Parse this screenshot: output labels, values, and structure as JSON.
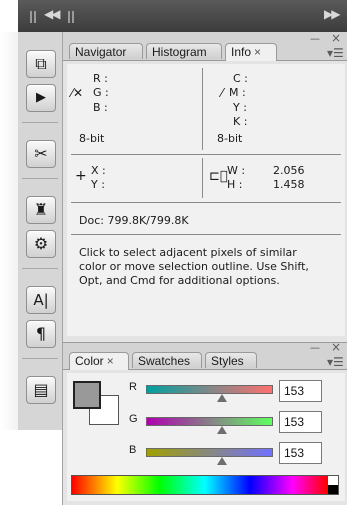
{
  "top_bar": {
    "collapse_icon": "double-left-arrow",
    "expand_icon": "double-right-arrow"
  },
  "tools": [
    {
      "name": "layer-comps-icon",
      "glyph": "⧉"
    },
    {
      "name": "actions-play-icon",
      "glyph": "▶"
    },
    {
      "name": "brushes-icon",
      "glyph": "✂"
    },
    {
      "name": "clone-source-icon",
      "glyph": "♜"
    },
    {
      "name": "tool-presets-icon",
      "glyph": "⚙"
    },
    {
      "name": "character-icon",
      "glyph": "A|"
    },
    {
      "name": "paragraph-icon",
      "glyph": "¶"
    },
    {
      "name": "notes-icon",
      "glyph": "▤"
    }
  ],
  "info_panel": {
    "tabs": [
      {
        "label": "Navigator"
      },
      {
        "label": "Histogram"
      },
      {
        "label": "Info",
        "close": "×"
      }
    ],
    "collapse": "––",
    "close": "×",
    "rgb": {
      "r_label": "R :",
      "g_label": "G :",
      "b_label": "B :",
      "bit_depth": "8-bit"
    },
    "cmyk": {
      "c_label": "C :",
      "m_label": "M :",
      "y_label": "Y :",
      "k_label": "K :",
      "bit_depth": "8-bit"
    },
    "xy": {
      "x_label": "X :",
      "y_label": "Y :"
    },
    "wh": {
      "w_label": "W :",
      "h_label": "H :",
      "w_value": "2.056",
      "h_value": "1.458"
    },
    "doc": "Doc: 799.8K/799.8K",
    "hint_lines": [
      "Click to select adjacent pixels of similar",
      "color or move selection outline.  Use Shift,",
      "Opt, and Cmd for additional options."
    ]
  },
  "color_panel": {
    "tabs": [
      {
        "label": "Color",
        "close": "×"
      },
      {
        "label": "Swatches"
      },
      {
        "label": "Styles"
      }
    ],
    "collapse": "––",
    "close": "×",
    "channels": [
      {
        "label": "R",
        "value": "153",
        "fraction": 0.6
      },
      {
        "label": "G",
        "value": "153",
        "fraction": 0.6
      },
      {
        "label": "B",
        "value": "153",
        "fraction": 0.6
      }
    ],
    "foreground_color": "#999999",
    "background_color": "#ffffff"
  }
}
